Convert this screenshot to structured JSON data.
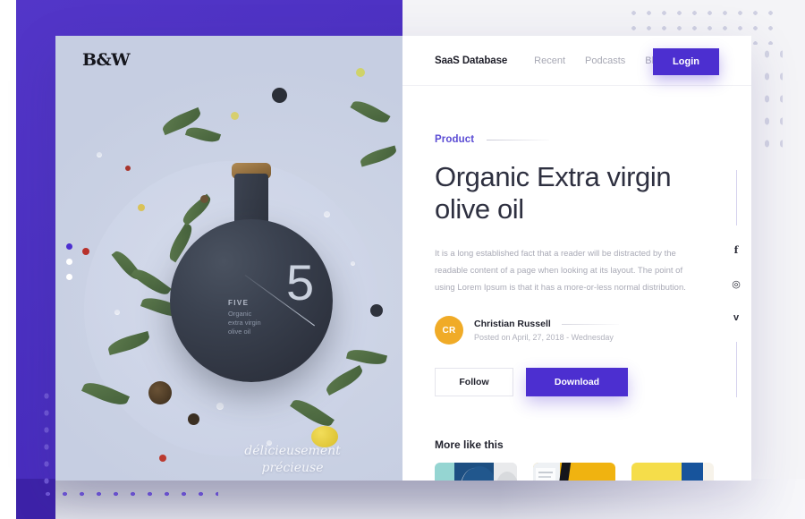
{
  "brand": {
    "hero_logo": "B&W"
  },
  "nav": {
    "brand": "SaaS Database",
    "links": [
      {
        "label": "Recent"
      },
      {
        "label": "Podcasts"
      },
      {
        "label": "Blog"
      }
    ],
    "login_label": "Login"
  },
  "article": {
    "eyebrow": "Product",
    "title": "Organic Extra virgin olive oil",
    "description": "It is a long established fact that a reader will be distracted by the readable content of a page when looking at its layout. The point of using Lorem Ipsum is that it has a more-or-less normal distribution.",
    "author": {
      "initials": "CR",
      "name": "Christian Russell",
      "date": "Posted on April, 27, 2018 - Wednesday",
      "avatar_color": "#f0ab27"
    },
    "buttons": {
      "follow": "Follow",
      "download": "Download"
    }
  },
  "social": {
    "items": [
      {
        "icon": "facebook-icon",
        "glyph": "f"
      },
      {
        "icon": "instagram-icon",
        "glyph": "◎"
      },
      {
        "icon": "twitter-icon",
        "glyph": "ᴠ"
      }
    ]
  },
  "more": {
    "heading": "More like this",
    "cards": [
      {
        "name": "thumbnail-teal-navy"
      },
      {
        "name": "thumbnail-yellow-coffee"
      },
      {
        "name": "thumbnail-primary-blocks"
      }
    ]
  },
  "hero": {
    "bottle": {
      "numeral": "5",
      "label_top": "FIVE",
      "label_sub": "Organic\nextra virgin\nolive oil"
    },
    "tagline_line1": "délicieusement",
    "tagline_line2": "précieuse",
    "carousel": {
      "active_index": 0,
      "count": 3
    }
  },
  "theme": {
    "purple": "#4c2fd0",
    "purple_dark": "#3d22a8",
    "accent_amber": "#f0ab27",
    "text_dark": "#23242f",
    "text_muted": "#a9aab6"
  }
}
